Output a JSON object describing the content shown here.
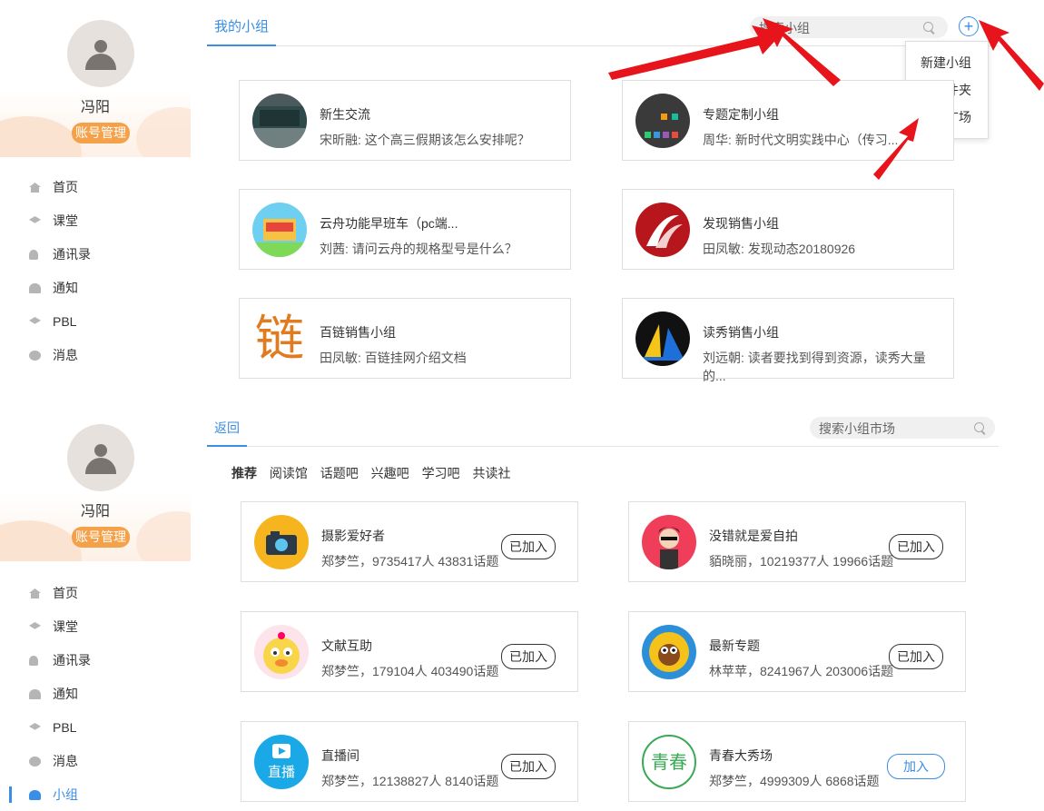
{
  "user": {
    "name": "冯阳",
    "account_button": "账号管理"
  },
  "nav": {
    "items": [
      "首页",
      "课堂",
      "通讯录",
      "通知",
      "PBL",
      "消息",
      "小组"
    ]
  },
  "screen1": {
    "tab": "我的小组",
    "search_placeholder": "搜索小组",
    "menu": [
      "新建小组",
      "建文件夹",
      "小组广场"
    ],
    "groups": [
      {
        "title": "新生交流",
        "sub": "宋昕融: 这个高三假期该怎么安排呢？"
      },
      {
        "title": "专题定制小组",
        "sub": "周华: 新时代文明实践中心（传习..."
      },
      {
        "title": "云舟功能早班车（pc端...",
        "sub": "刘茜: 请问云舟的规格型号是什么？"
      },
      {
        "title": "发现销售小组",
        "sub": "田凤敏: 发现动态20180926"
      },
      {
        "title": "百链销售小组",
        "sub": "田凤敏: 百链挂网介绍文档"
      },
      {
        "title": "读秀销售小组",
        "sub": "刘远朝: 读者要找到得到资源，读秀大量的..."
      }
    ],
    "logo_text": {
      "bailian": "链"
    }
  },
  "screen2": {
    "back_tab": "返回",
    "search_placeholder": "搜索小组市场",
    "categories": [
      "推荐",
      "阅读馆",
      "话题吧",
      "兴趣吧",
      "学习吧",
      "共读社"
    ],
    "groups": [
      {
        "title": "摄影爱好者",
        "sub": "郑梦竺，9735417人  43831话题",
        "button": "已加入"
      },
      {
        "title": "没错就是爱自拍",
        "sub": "貊晓丽，10219377人  19966话题",
        "button": "已加入"
      },
      {
        "title": "文献互助",
        "sub": "郑梦竺，179104人  403490话题",
        "button": "已加入"
      },
      {
        "title": "最新专题",
        "sub": "林苹苹，8241967人  203006话题",
        "button": "已加入"
      },
      {
        "title": "直播间",
        "sub": "郑梦竺，12138827人  8140话题",
        "button": "已加入"
      },
      {
        "title": "青春大秀场",
        "sub": "郑梦竺，4999309人  6868话题",
        "button": "加入"
      }
    ],
    "logo_text": {
      "live": "直播",
      "youth": "青春"
    }
  }
}
